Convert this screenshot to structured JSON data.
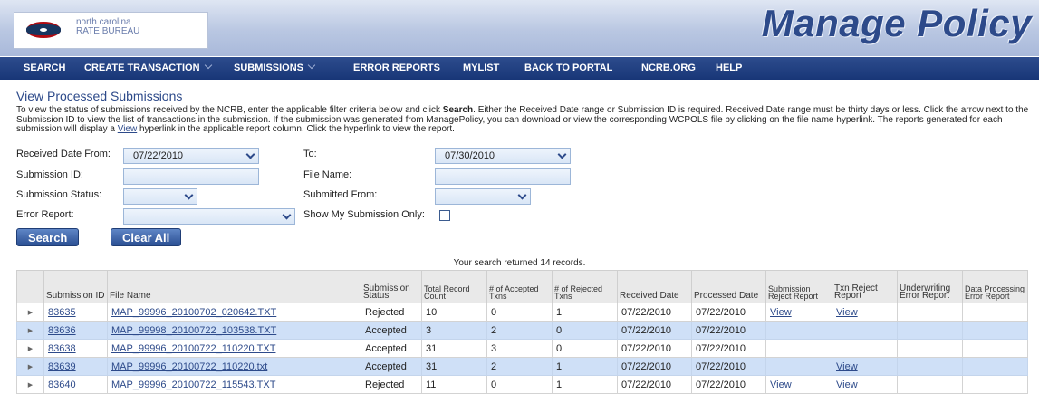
{
  "header": {
    "logo_line1": "north carolina",
    "logo_line2": "RATE BUREAU",
    "title": "Manage Policy"
  },
  "nav": {
    "search": "SEARCH",
    "create_transaction": "CREATE TRANSACTION",
    "submissions": "SUBMISSIONS",
    "error_reports": "ERROR REPORTS",
    "mylist": "MYLIST",
    "back_to_portal": "BACK TO PORTAL",
    "ncrb_org": "NCRB.ORG",
    "help": "HELP"
  },
  "page": {
    "title": "View Processed Submissions",
    "instructions_1": "To view the status of submissions received by the NCRB, enter the applicable filter criteria below and click ",
    "instructions_bold": "Search",
    "instructions_2": ". Either the Received Date range or Submission ID is required. Received Date range must be thirty days or less. Click the arrow next to the Submission ID to view the list of transactions in the submission. If the submission was generated from ManagePolicy, you can download or view the corresponding WCPOLS file by clicking on the file name hyperlink. The reports generated for each submission will display a ",
    "instructions_link": "View",
    "instructions_3": " hyperlink in the applicable report column. Click the hyperlink to view the report."
  },
  "filters": {
    "received_from_label": "Received Date From:",
    "received_from_value": "07/22/2010",
    "to_label": "To:",
    "to_value": "07/30/2010",
    "submission_id_label": "Submission ID:",
    "file_name_label": "File Name:",
    "submission_status_label": "Submission Status:",
    "submitted_from_label": "Submitted From:",
    "error_report_label": "Error Report:",
    "show_my_label": "Show My Submission Only:",
    "search_button": "Search",
    "clear_button": "Clear All"
  },
  "results": {
    "count_text": "Your search returned 14 records.",
    "columns": {
      "submission_id": "Submission ID",
      "file_name": "File Name",
      "status": "Submission Status",
      "total": "Total Record Count",
      "accepted": "# of Accepted Txns",
      "rejected": "# of Rejected Txns",
      "received": "Received Date",
      "processed": "Processed Date",
      "sub_reject": "Submission Reject Report",
      "txn_reject": "Txn Reject Report",
      "uw_error": "Underwriting Error Report",
      "dp_error": "Data Processing Error Report"
    },
    "rows": [
      {
        "id": "83635",
        "file": "MAP_99996_20100702_020642.TXT",
        "status": "Rejected",
        "total": "10",
        "accepted": "0",
        "rejected": "1",
        "received": "07/22/2010",
        "processed": "07/22/2010",
        "sub_reject": "View",
        "txn_reject": "View",
        "uw": "",
        "dp": ""
      },
      {
        "id": "83636",
        "file": "MAP_99998_20100722_103538.TXT",
        "status": "Accepted",
        "total": "3",
        "accepted": "2",
        "rejected": "0",
        "received": "07/22/2010",
        "processed": "07/22/2010",
        "sub_reject": "",
        "txn_reject": "",
        "uw": "",
        "dp": ""
      },
      {
        "id": "83638",
        "file": "MAP_99996_20100722_110220.TXT",
        "status": "Accepted",
        "total": "31",
        "accepted": "3",
        "rejected": "0",
        "received": "07/22/2010",
        "processed": "07/22/2010",
        "sub_reject": "",
        "txn_reject": "",
        "uw": "",
        "dp": ""
      },
      {
        "id": "83639",
        "file": "MAP_99996_20100722_110220.txt",
        "status": "Accepted",
        "total": "31",
        "accepted": "2",
        "rejected": "1",
        "received": "07/22/2010",
        "processed": "07/22/2010",
        "sub_reject": "",
        "txn_reject": "View",
        "uw": "",
        "dp": ""
      },
      {
        "id": "83640",
        "file": "MAP_99996_20100722_115543.TXT",
        "status": "Rejected",
        "total": "11",
        "accepted": "0",
        "rejected": "1",
        "received": "07/22/2010",
        "processed": "07/22/2010",
        "sub_reject": "View",
        "txn_reject": "View",
        "uw": "",
        "dp": ""
      }
    ]
  },
  "icons": {
    "expand": "expand-arrow-icon",
    "dropdown": "chevron-down-icon"
  },
  "colors": {
    "nav_bg": "#1f3c7c",
    "title_blue": "#2d4a8a",
    "row_alt": "#cfe0f7"
  }
}
